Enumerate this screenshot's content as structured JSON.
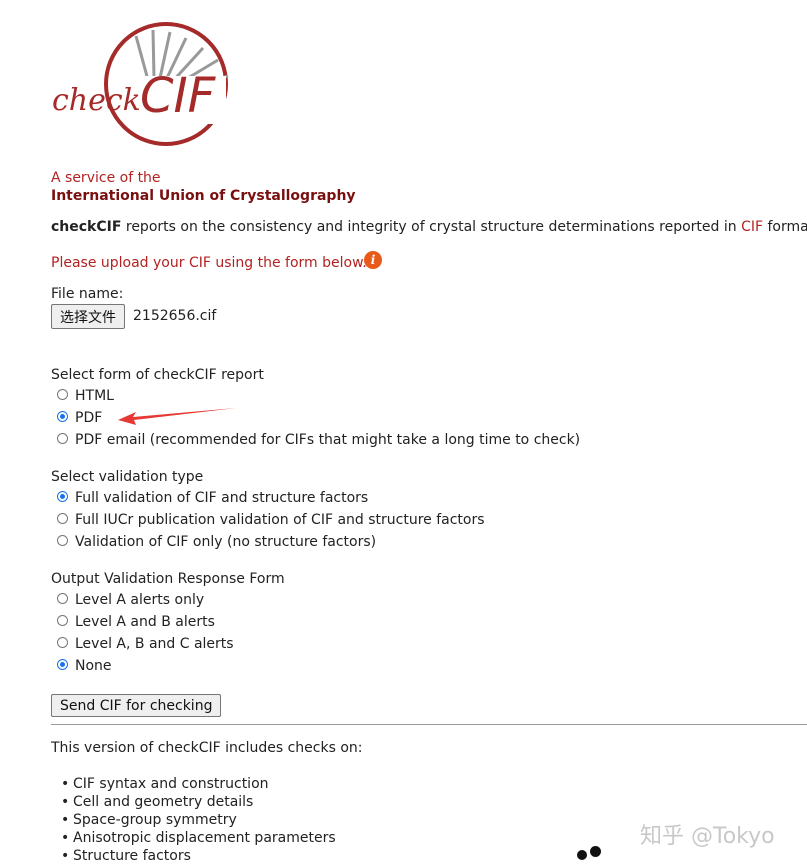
{
  "logo": {
    "text_check": "check",
    "text_cif": "CIF"
  },
  "service": {
    "line1": "A service of the",
    "line2": "International Union of Crystallography"
  },
  "intro": {
    "bold": "checkCIF",
    "middle": " reports on the consistency and integrity of crystal structure determinations reported in ",
    "cif": "CIF",
    "tail": " format."
  },
  "upload_notice": "Please upload your CIF using the form below.",
  "file": {
    "label": "File name:",
    "choose_button": "选择文件",
    "filename": "2152656.cif"
  },
  "report_form": {
    "heading": "Select form of checkCIF report",
    "options": [
      {
        "label": "HTML",
        "checked": false
      },
      {
        "label": "PDF",
        "checked": true
      },
      {
        "label": "PDF email (recommended for CIFs that might take a long time to check)",
        "checked": false
      }
    ]
  },
  "validation_type": {
    "heading": "Select validation type",
    "options": [
      {
        "label": "Full validation of CIF and structure factors",
        "checked": true
      },
      {
        "label": "Full IUCr publication validation of CIF and structure factors",
        "checked": false
      },
      {
        "label": "Validation of CIF only (no structure factors)",
        "checked": false
      }
    ]
  },
  "response_form": {
    "heading": "Output Validation Response Form",
    "options": [
      {
        "label": "Level A alerts only",
        "checked": false
      },
      {
        "label": "Level A and B alerts",
        "checked": false
      },
      {
        "label": "Level A, B and C alerts",
        "checked": false
      },
      {
        "label": "None",
        "checked": true
      }
    ]
  },
  "submit_button": "Send CIF for checking",
  "version_text": "This version of checkCIF includes checks on:",
  "checks": [
    "CIF syntax and construction",
    "Cell and geometry details",
    "Space-group symmetry",
    "Anisotropic displacement parameters",
    "Structure factors"
  ],
  "watermark": "知乎 @Tokyo",
  "colors": {
    "accent": "#b22222",
    "logo": "#a52a2a",
    "arrow": "#e53935",
    "radio": "#1a73e8"
  },
  "icons": [
    "info-icon",
    "red-arrow-annotation",
    "loading-dots"
  ]
}
